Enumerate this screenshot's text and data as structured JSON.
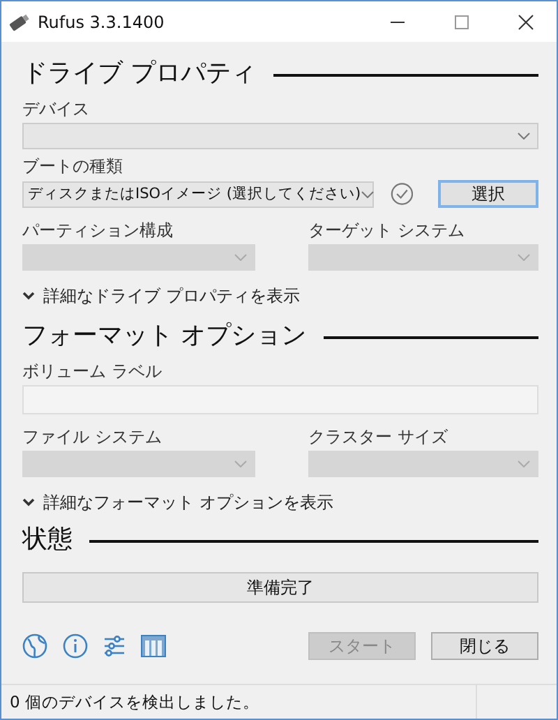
{
  "window": {
    "title": "Rufus 3.3.1400"
  },
  "drive_properties": {
    "heading": "ドライブ プロパティ",
    "device": {
      "label": "デバイス",
      "disabled": false
    },
    "boot_selection": {
      "label": "ブートの種類",
      "value": "ディスクまたはISOイメージ (選択してください)",
      "disabled": false,
      "select_button": "選択"
    },
    "partition_scheme": {
      "label": "パーティション構成",
      "disabled": true
    },
    "target_system": {
      "label": "ターゲット システム",
      "disabled": true
    },
    "advanced_toggle": {
      "label": "詳細なドライブ プロパティを表示",
      "expanded": false
    }
  },
  "format_options": {
    "heading": "フォーマット オプション",
    "volume_label": {
      "label": "ボリューム ラベル",
      "disabled": true
    },
    "file_system": {
      "label": "ファイル システム",
      "disabled": true
    },
    "cluster_size": {
      "label": "クラスター サイズ",
      "disabled": true
    },
    "advanced_toggle": {
      "label": "詳細なフォーマット オプションを表示",
      "expanded": false
    }
  },
  "status": {
    "heading": "状態",
    "progress_text": "準備完了"
  },
  "buttons": [
    {
      "label": "スタート",
      "disabled": true
    },
    {
      "label": "閉じる",
      "disabled": false
    }
  ],
  "status_bar": {
    "text": "0 個のデバイスを検出しました。"
  }
}
